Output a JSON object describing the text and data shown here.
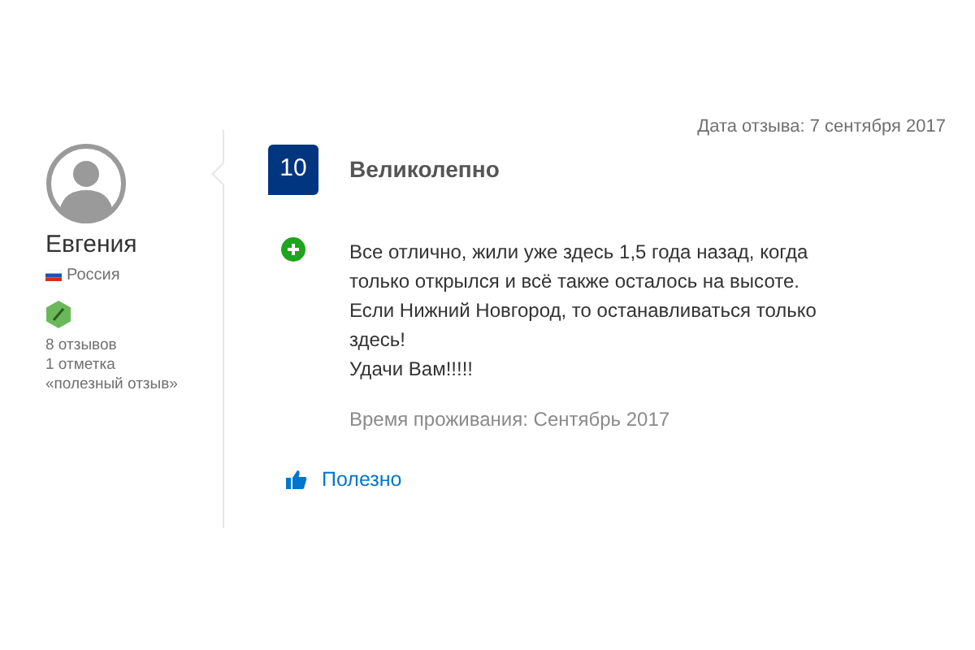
{
  "reviewer": {
    "name": "Евгения",
    "country": "Россия",
    "stats": [
      "8 отзывов",
      "1 отметка",
      "«полезный отзыв»"
    ]
  },
  "review": {
    "date": "Дата отзыва: 7 сентября 2017",
    "score": "10",
    "title": "Великолепно",
    "positive": "Все отлично, жили уже здесь 1,5 года назад, когда только открылся и всё также осталось на высоте. Если Нижний Новгород, то останавливаться только здесь!\nУдачи Вам!!!!!",
    "stay": "Время проживания: Сентябрь 2017",
    "helpful": "Полезно"
  }
}
